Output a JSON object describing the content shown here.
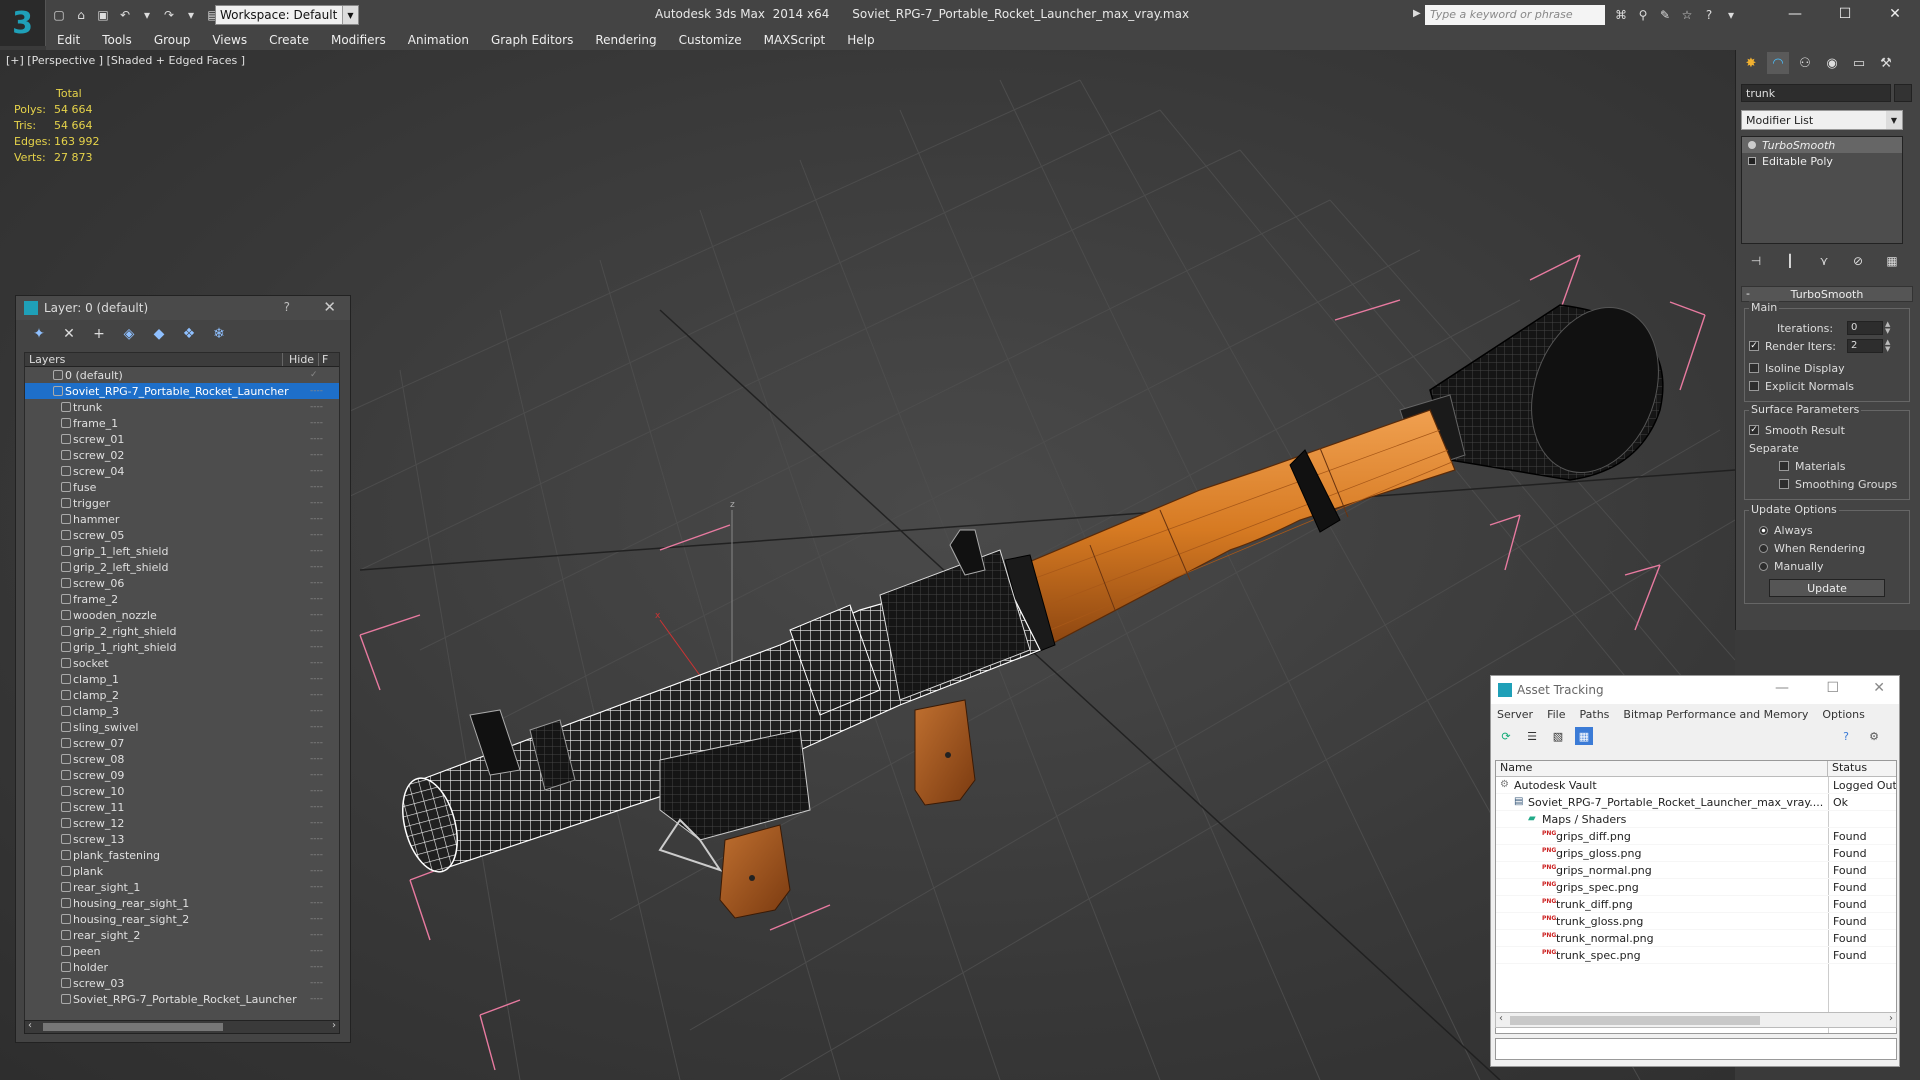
{
  "app": {
    "title": "Autodesk 3ds Max  2014 x64      Soviet_RPG-7_Portable_Rocket_Launcher_max_vray.max",
    "workspace": "Workspace: Default",
    "search_placeholder": "Type a keyword or phrase"
  },
  "menu": [
    "Edit",
    "Tools",
    "Group",
    "Views",
    "Create",
    "Modifiers",
    "Animation",
    "Graph Editors",
    "Rendering",
    "Customize",
    "MAXScript",
    "Help"
  ],
  "viewport": {
    "label": "[+] [Perspective ] [Shaded + Edged Faces ]",
    "stats": {
      "header": "Total",
      "rows": [
        {
          "k": "Polys:",
          "v": "54 664"
        },
        {
          "k": "Tris:",
          "v": "54 664"
        },
        {
          "k": "Edges:",
          "v": "163 992"
        },
        {
          "k": "Verts:",
          "v": "27 873"
        }
      ]
    }
  },
  "layer_panel": {
    "title": "Layer: 0 (default)",
    "help": "?",
    "col_layers": "Layers",
    "col_hide": "Hide",
    "col_f": "F",
    "layers": [
      {
        "name": "0 (default)",
        "type": "layer",
        "hide": "✓"
      },
      {
        "name": "Soviet_RPG-7_Portable_Rocket_Launcher",
        "type": "layer",
        "selected": true,
        "hide": ""
      }
    ],
    "objects": [
      "trunk",
      "frame_1",
      "screw_01",
      "screw_02",
      "screw_04",
      "fuse",
      "trigger",
      "hammer",
      "screw_05",
      "grip_1_left_shield",
      "grip_2_left_shield",
      "screw_06",
      "frame_2",
      "wooden_nozzle",
      "grip_2_right_shield",
      "grip_1_right_shield",
      "socket",
      "clamp_1",
      "clamp_2",
      "clamp_3",
      "sling_swivel",
      "screw_07",
      "screw_08",
      "screw_09",
      "screw_10",
      "screw_11",
      "screw_12",
      "screw_13",
      "plank_fastening",
      "plank",
      "rear_sight_1",
      "housing_rear_sight_1",
      "housing_rear_sight_2",
      "rear_sight_2",
      "peen",
      "holder",
      "screw_03",
      "Soviet_RPG-7_Portable_Rocket_Launcher"
    ],
    "hide_mark": "----"
  },
  "command_panel": {
    "object_name": "trunk",
    "modifier_list": "Modifier List",
    "stack": [
      "TurboSmooth",
      "Editable Poly"
    ],
    "rollout_title": "TurboSmooth",
    "main_group": "Main",
    "iterations_label": "Iterations:",
    "iterations_value": "0",
    "render_iters_label": "Render Iters:",
    "render_iters_value": "2",
    "isoline_label": "Isoline Display",
    "explicit_normals_label": "Explicit Normals",
    "surface_group": "Surface Parameters",
    "smooth_result_label": "Smooth Result",
    "separate_label": "Separate",
    "materials_label": "Materials",
    "smoothing_groups_label": "Smoothing Groups",
    "update_group": "Update Options",
    "always_label": "Always",
    "when_rendering_label": "When Rendering",
    "manually_label": "Manually",
    "update_button": "Update"
  },
  "asset_panel": {
    "title": "Asset Tracking",
    "menu": [
      "Server",
      "File",
      "Paths",
      "Bitmap Performance and Memory",
      "Options"
    ],
    "col_name": "Name",
    "col_status": "Status",
    "rows": [
      {
        "name": "Autodesk Vault",
        "status": "Logged Out",
        "indent": 0,
        "kind": "vault"
      },
      {
        "name": "Soviet_RPG-7_Portable_Rocket_Launcher_max_vray....",
        "status": "Ok",
        "indent": 1,
        "kind": "file"
      },
      {
        "name": "Maps / Shaders",
        "status": "",
        "indent": 2,
        "kind": "folder"
      },
      {
        "name": "grips_diff.png",
        "status": "Found",
        "indent": 3,
        "kind": "png"
      },
      {
        "name": "grips_gloss.png",
        "status": "Found",
        "indent": 3,
        "kind": "png"
      },
      {
        "name": "grips_normal.png",
        "status": "Found",
        "indent": 3,
        "kind": "png"
      },
      {
        "name": "grips_spec.png",
        "status": "Found",
        "indent": 3,
        "kind": "png"
      },
      {
        "name": "trunk_diff.png",
        "status": "Found",
        "indent": 3,
        "kind": "png"
      },
      {
        "name": "trunk_gloss.png",
        "status": "Found",
        "indent": 3,
        "kind": "png"
      },
      {
        "name": "trunk_normal.png",
        "status": "Found",
        "indent": 3,
        "kind": "png"
      },
      {
        "name": "trunk_spec.png",
        "status": "Found",
        "indent": 3,
        "kind": "png"
      }
    ],
    "png_badge": "PNG"
  },
  "colors": {
    "accent": "#1e6fc9",
    "stats_text": "#e6d34a",
    "wood": "#d9812a",
    "selection_box": "#e87aa0"
  }
}
